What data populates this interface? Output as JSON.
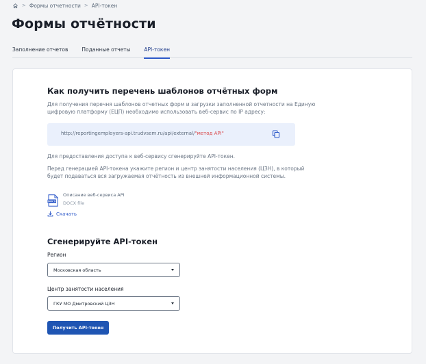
{
  "breadcrumbs": {
    "home_icon": "home-icon",
    "items": [
      "Формы отчетности",
      "API-токен"
    ]
  },
  "page": {
    "title": "Формы отчётности"
  },
  "tabs": [
    {
      "label": "Заполнение отчетов",
      "active": false
    },
    {
      "label": "Поданные отчеты",
      "active": false
    },
    {
      "label": "API-токен",
      "active": true
    }
  ],
  "info": {
    "title": "Как получить перечень шаблонов отчётных форм",
    "description": "Для получения перечня шаблонов отчетных форм и загрузки заполненной отчетности на Единую цифровую платформу (ЕЦП) необходимо использовать веб-сервис по IP адресу:",
    "url_prefix": "http://reportingemployers-api.trudvsem.ru/api/external/",
    "url_method": "\"метод API\"",
    "access_text": "Для предоставления доступа к веб-сервису сгенерируйте API-токен.",
    "region_note": "Перед генерацией API-токена укажите регион и центр занятости населения (ЦЗН), в который будет подаваться вся загружаемая отчётность из внешней информационной системы.",
    "file_name": "Описание веб-сервиса API",
    "file_type": "DOCX file",
    "file_badge": "DOCX",
    "download_label": "Скачать"
  },
  "generate": {
    "title": "Сгенерируйте API-токен",
    "region_label": "Регион",
    "region_value": "Московская область",
    "center_label": "Центр занятости населения",
    "center_value": "ГКУ МО Дмитровский ЦЗН",
    "button_label": "Получить API-токен"
  },
  "colors": {
    "accent": "#1f55b3",
    "link": "#2b57c8",
    "url_box_bg": "#eaf0fc",
    "method_highlight": "#d9484b"
  }
}
